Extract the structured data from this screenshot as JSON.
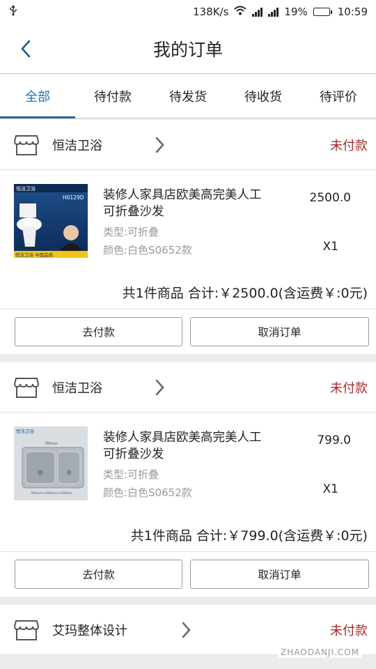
{
  "status_bar": {
    "net_speed": "138K/s",
    "battery": "19%",
    "battery_fraction": 0.19,
    "time": "10:59",
    "icons": [
      "usb-icon",
      "wifi-icon",
      "signal-icon",
      "signal-icon",
      "battery-icon"
    ]
  },
  "header": {
    "title": "我的订单",
    "back_icon": "chevron-left-icon"
  },
  "tabs": [
    {
      "label": "全部",
      "active": true
    },
    {
      "label": "待付款"
    },
    {
      "label": "待发货"
    },
    {
      "label": "待收货"
    },
    {
      "label": "待评价"
    }
  ],
  "orders": [
    {
      "shop": "恒洁卫浴",
      "status": "未付款",
      "item": {
        "title": "装修人家具店欧美高完美人工可折叠沙发",
        "type": "类型:可折叠",
        "color": "颜色:白色S0652款",
        "price": "2500.0",
        "qty": "X1",
        "image_brand": "恒洁卫浴",
        "image_model": "H0129D",
        "image_slogan": "恒洁卫浴 中国品质"
      },
      "total": "共1件商品 合计:￥2500.0(含运费￥:0元)",
      "pay_label": "去付款",
      "cancel_label": "取消订单"
    },
    {
      "shop": "恒洁卫浴",
      "status": "未付款",
      "item": {
        "title": "装修人家具店欧美高完美人工可折叠沙发",
        "type": "类型:可折叠",
        "color": "颜色:白色S0652款",
        "price": "799.0",
        "qty": "X1",
        "image_brand": "恒洁卫浴",
        "image_dim_top": "780mm",
        "image_dim_bottom": "780mm×420mm×150mm"
      },
      "total": "共1件商品 合计:￥799.0(含运费￥:0元)",
      "pay_label": "去付款",
      "cancel_label": "取消订单"
    },
    {
      "shop": "艾玛整体设计",
      "status": "未付款"
    }
  ],
  "watermark": "ZHAODANJI.COM",
  "colors": {
    "accent": "#1a73b8",
    "status_unpaid": "#a52a2a",
    "tab_indicator": "#2a5f8f"
  }
}
